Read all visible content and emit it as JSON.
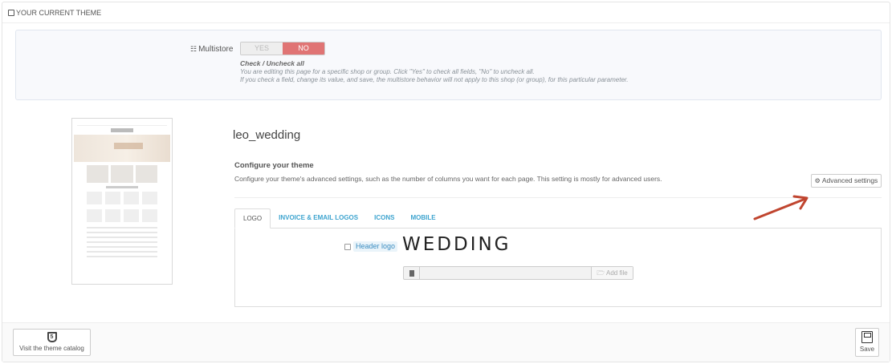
{
  "panel": {
    "title": "YOUR CURRENT THEME"
  },
  "multistore": {
    "label": "Multistore",
    "yes_label": "YES",
    "no_label": "NO",
    "help_title": "Check / Uncheck all",
    "help_line1": "You are editing this page for a specific shop or group. Click \"Yes\" to check all fields, \"No\" to uncheck all.",
    "help_line2": "If you check a field, change its value, and save, the multistore behavior will not apply to this shop (or group), for this particular parameter."
  },
  "theme": {
    "name": "leo_wedding",
    "config_title": "Configure your theme",
    "config_desc": "Configure your theme's advanced settings, such as the number of columns you want for each page. This setting is mostly for advanced users.",
    "advanced_button": "Advanced settings"
  },
  "tabs": [
    {
      "label": "LOGO"
    },
    {
      "label": "INVOICE & EMAIL LOGOS"
    },
    {
      "label": "ICONS"
    },
    {
      "label": "MOBILE"
    }
  ],
  "logo": {
    "header_logo_label": "Header logo",
    "logo_text": "WEDDING",
    "add_file_label": "Add file"
  },
  "footer": {
    "visit_catalog": "Visit the theme catalog",
    "save": "Save"
  },
  "colors": {
    "accent": "#3ea4cf",
    "no_toggle": "#e07474",
    "arrow": "#c0452f"
  }
}
